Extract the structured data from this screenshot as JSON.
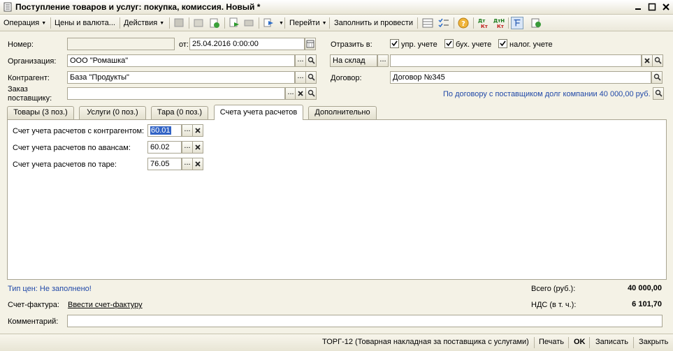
{
  "window": {
    "title": "Поступление товаров и услуг: покупка, комиссия. Новый *"
  },
  "toolbar": {
    "operation": "Операция",
    "prices": "Цены и валюта...",
    "actions": "Действия",
    "goto": "Перейти",
    "fill_and_post": "Заполнить и провести"
  },
  "form": {
    "number_label": "Номер:",
    "number_value": "",
    "date_label": "от:",
    "date_value": "25.04.2016  0:00:00",
    "reflect_label": "Отразить в:",
    "chk_mgmt": "упр. учете",
    "chk_acct": "бух. учете",
    "chk_tax": "налог. учете",
    "org_label": "Организация:",
    "org_value": "ООО \"Ромашка\"",
    "warehouse_mode": "На склад",
    "warehouse_value": "",
    "contractor_label": "Контрагент:",
    "contractor_value": "База \"Продукты\"",
    "contract_label": "Договор:",
    "contract_value": "Договор №345",
    "order_label_1": "Заказ",
    "order_label_2": "поставщику:",
    "order_value": "",
    "debt_info": "По договору с поставщиком долг компании 40 000,00 руб."
  },
  "tabs": [
    {
      "label": "Товары (3 поз.)"
    },
    {
      "label": "Услуги (0 поз.)"
    },
    {
      "label": "Тара (0 поз.)"
    },
    {
      "label": "Счета учета расчетов"
    },
    {
      "label": "Дополнительно"
    }
  ],
  "accounts": {
    "contractor_label": "Счет учета расчетов с контрагентом:",
    "contractor_value": "60.01",
    "advances_label": "Счет учета расчетов по авансам:",
    "advances_value": "60.02",
    "tare_label": "Счет учета расчетов по таре:",
    "tare_value": "76.05"
  },
  "footer": {
    "price_type": "Тип цен: Не заполнено!",
    "total_label": "Всего (руб.):",
    "total_value": "40 000,00",
    "vat_label": "НДС (в т. ч.):",
    "vat_value": "6 101,70",
    "invoice_label": "Счет-фактура:",
    "invoice_link": "Ввести счет-фактуру",
    "comment_label": "Комментарий:",
    "comment_value": ""
  },
  "bottombar": {
    "torg": "ТОРГ-12 (Товарная накладная за поставщика с услугами)",
    "print": "Печать",
    "ok": "OK",
    "save": "Записать",
    "close": "Закрыть"
  }
}
